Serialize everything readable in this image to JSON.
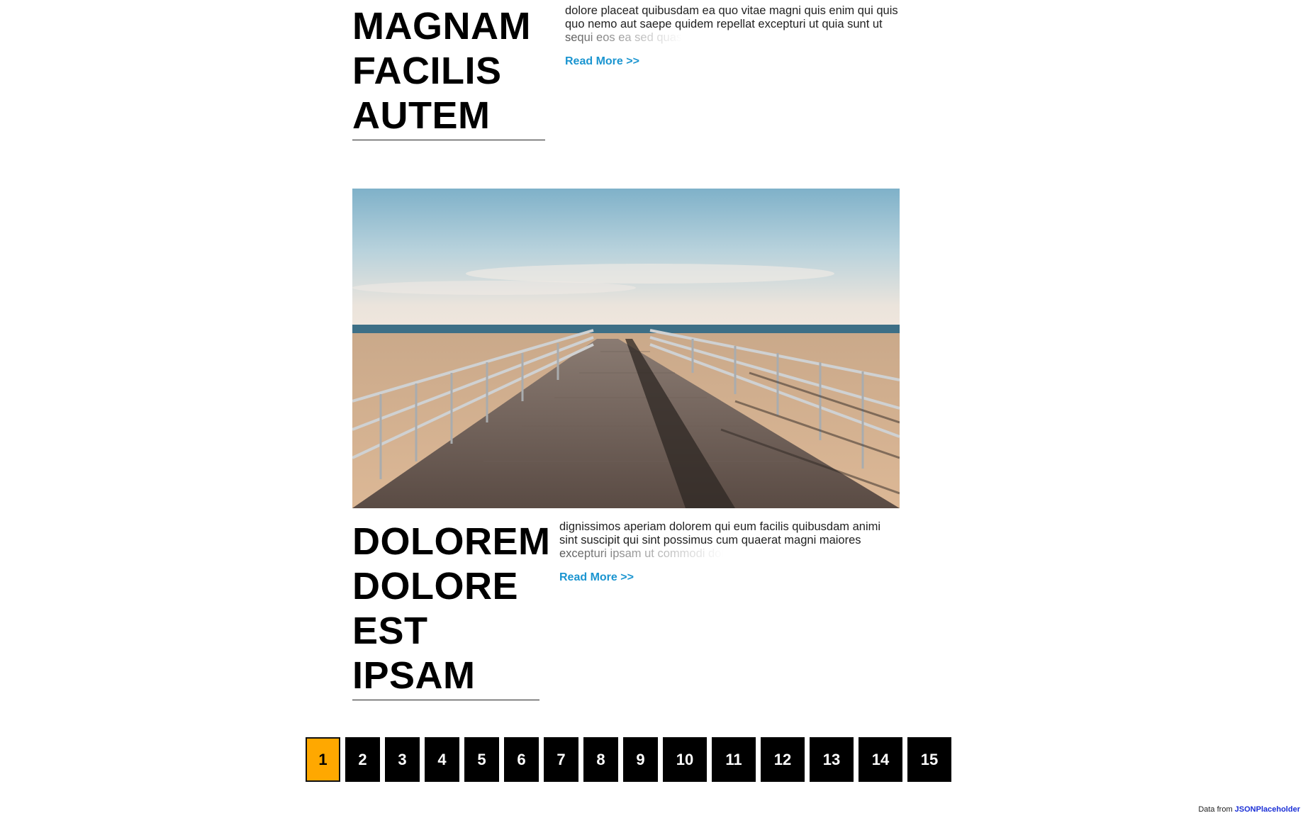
{
  "posts": [
    {
      "title_lines": [
        "MAGNAM",
        "FACILIS",
        "AUTEM"
      ],
      "excerpt": "dolore placeat quibusdam ea quo vitae magni quis enim qui quis quo nemo aut saepe quidem repellat excepturi ut quia sunt ut",
      "excerpt_fade": "sequi eos ea sed quas",
      "read_more": "Read More >>"
    },
    {
      "title_lines": [
        "DOLOREM",
        "DOLORE",
        "EST",
        "IPSAM"
      ],
      "excerpt": "dignissimos aperiam dolorem qui eum facilis quibusdam animi sint suscipit qui sint possimus cum quaerat magni maiores",
      "excerpt_fade": "excepturi ipsam ut commodi dol",
      "read_more": "Read More >>"
    }
  ],
  "pagination": {
    "pages": [
      "1",
      "2",
      "3",
      "4",
      "5",
      "6",
      "7",
      "8",
      "9",
      "10",
      "11",
      "12",
      "13",
      "14",
      "15"
    ],
    "active": "1",
    "colors": {
      "active_bg": "#ffa800",
      "default_bg": "#000000"
    }
  },
  "credit": {
    "prefix": "Data from",
    "link": "JSONPlaceholder"
  },
  "colors": {
    "link": "#1b95d0",
    "credit_link": "#1a2fd6"
  }
}
